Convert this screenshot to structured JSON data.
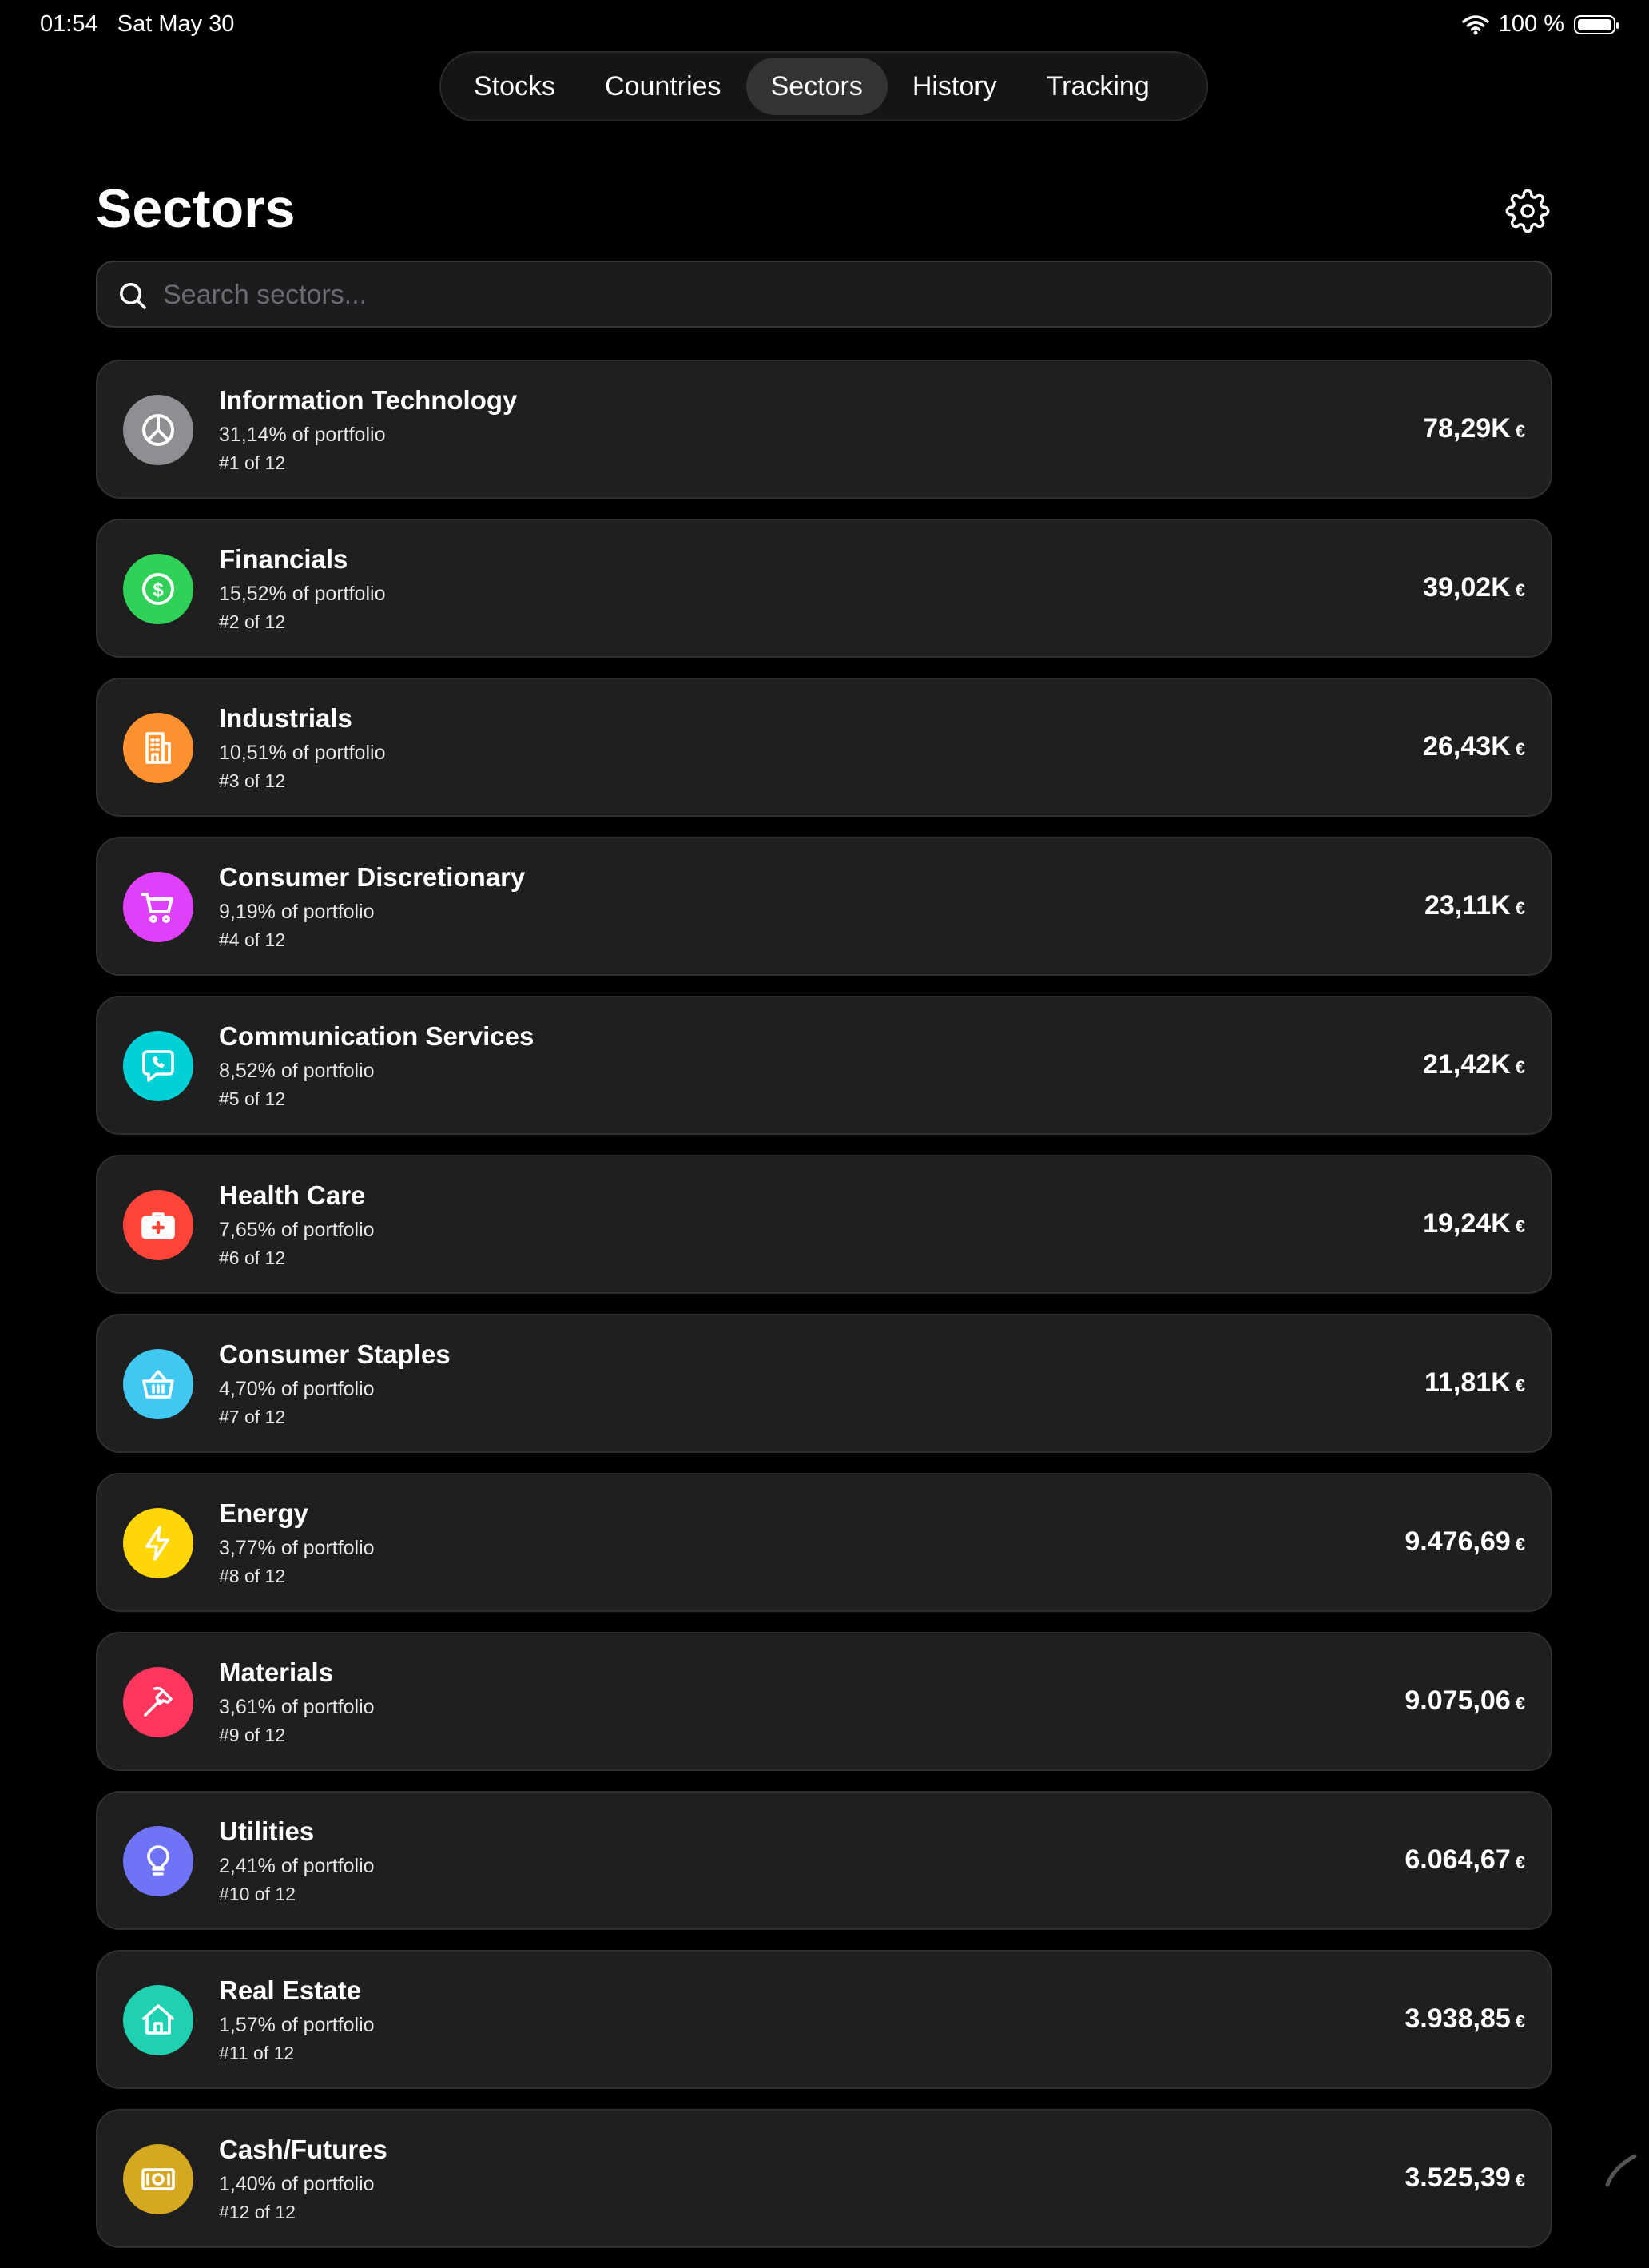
{
  "status": {
    "time": "01:54",
    "date": "Sat May 30",
    "battery": "100 %"
  },
  "tabs": [
    {
      "label": "Stocks",
      "active": false
    },
    {
      "label": "Countries",
      "active": false
    },
    {
      "label": "Sectors",
      "active": true
    },
    {
      "label": "History",
      "active": false
    },
    {
      "label": "Tracking",
      "active": false
    }
  ],
  "page": {
    "title": "Sectors"
  },
  "search": {
    "placeholder": "Search sectors..."
  },
  "sectors": [
    {
      "name": "Information Technology",
      "pct": "31,14% of portfolio",
      "rank": "#1 of 12",
      "value": "78,29K",
      "currency": "€",
      "color": "#8e8e93",
      "icon": "pie-chart-icon"
    },
    {
      "name": "Financials",
      "pct": "15,52% of portfolio",
      "rank": "#2 of 12",
      "value": "39,02K",
      "currency": "€",
      "color": "#30d158",
      "icon": "dollar-circle-icon"
    },
    {
      "name": "Industrials",
      "pct": "10,51% of portfolio",
      "rank": "#3 of 12",
      "value": "26,43K",
      "currency": "€",
      "color": "#ff9230",
      "icon": "building-icon"
    },
    {
      "name": "Consumer Discretionary",
      "pct": "9,19% of portfolio",
      "rank": "#4 of 12",
      "value": "23,11K",
      "currency": "€",
      "color": "#e040fb",
      "icon": "cart-icon"
    },
    {
      "name": "Communication Services",
      "pct": "8,52% of portfolio",
      "rank": "#5 of 12",
      "value": "21,42K",
      "currency": "€",
      "color": "#00d1d6",
      "icon": "phone-bubble-icon"
    },
    {
      "name": "Health Care",
      "pct": "7,65% of portfolio",
      "rank": "#6 of 12",
      "value": "19,24K",
      "currency": "€",
      "color": "#ff453a",
      "icon": "medical-kit-icon"
    },
    {
      "name": "Consumer Staples",
      "pct": "4,70% of portfolio",
      "rank": "#7 of 12",
      "value": "11,81K",
      "currency": "€",
      "color": "#40c8f0",
      "icon": "basket-icon"
    },
    {
      "name": "Energy",
      "pct": "3,77% of portfolio",
      "rank": "#8 of 12",
      "value": "9.476,69",
      "currency": "€",
      "color": "#ffd60a",
      "icon": "bolt-icon"
    },
    {
      "name": "Materials",
      "pct": "3,61% of portfolio",
      "rank": "#9 of 12",
      "value": "9.075,06",
      "currency": "€",
      "color": "#ff375f",
      "icon": "hammer-icon"
    },
    {
      "name": "Utilities",
      "pct": "2,41% of portfolio",
      "rank": "#10 of 12",
      "value": "6.064,67",
      "currency": "€",
      "color": "#6e74f5",
      "icon": "lightbulb-icon"
    },
    {
      "name": "Real Estate",
      "pct": "1,57% of portfolio",
      "rank": "#11 of 12",
      "value": "3.938,85",
      "currency": "€",
      "color": "#1fd1b0",
      "icon": "house-icon"
    },
    {
      "name": "Cash/Futures",
      "pct": "1,40% of portfolio",
      "rank": "#12 of 12",
      "value": "3.525,39",
      "currency": "€",
      "color": "#d4a820",
      "icon": "banknote-icon"
    }
  ]
}
